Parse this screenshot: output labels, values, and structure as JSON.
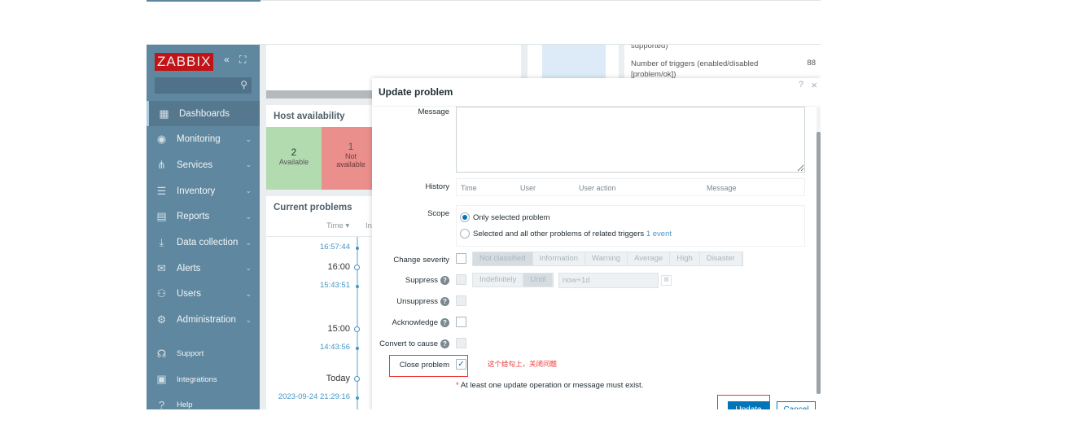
{
  "sidebar": {
    "logo": "ZABBIX",
    "items": [
      {
        "label": "Dashboards",
        "icon": "dashboard-icon",
        "active": true
      },
      {
        "label": "Monitoring",
        "icon": "eye-icon"
      },
      {
        "label": "Services",
        "icon": "hierarchy-icon"
      },
      {
        "label": "Inventory",
        "icon": "list-icon"
      },
      {
        "label": "Reports",
        "icon": "report-icon"
      },
      {
        "label": "Data collection",
        "icon": "download-icon"
      },
      {
        "label": "Alerts",
        "icon": "envelope-icon"
      },
      {
        "label": "Users",
        "icon": "users-icon"
      },
      {
        "label": "Administration",
        "icon": "gear-icon"
      }
    ],
    "bottom": [
      {
        "label": "Support",
        "icon": "headset-icon"
      },
      {
        "label": "Integrations",
        "icon": "integrations-icon"
      },
      {
        "label": "Help",
        "icon": "help-icon"
      }
    ]
  },
  "widgets": {
    "host_availability": {
      "title": "Host availability",
      "available_count": "2",
      "available_label": "Available",
      "not_available_count": "1",
      "not_available_label": "Not available",
      "colors": {
        "available": "#b2dcb0",
        "not_available": "#eb8f8d"
      }
    },
    "current_problems": {
      "title": "Current problems",
      "col_time": "Time ▾",
      "col_info": "In",
      "rows": [
        {
          "text": "16:57:44",
          "type": "event"
        },
        {
          "text": "16:00",
          "type": "mark"
        },
        {
          "text": "15:43:51",
          "type": "event"
        },
        {
          "text": "15:00",
          "type": "mark"
        },
        {
          "text": "14:43:56",
          "type": "event"
        },
        {
          "text": "Today",
          "type": "mark"
        },
        {
          "text": "2023-09-24 21:29:16",
          "type": "event"
        }
      ]
    },
    "system_info": {
      "row0": "supported)",
      "row1_label": "Number of triggers (enabled/disabled [problem/ok])",
      "row1_value": "88"
    }
  },
  "modal": {
    "title": "Update problem",
    "help": "?",
    "close": "×",
    "message_label": "Message",
    "history_label": "History",
    "history_cols": [
      "Time",
      "User",
      "User action",
      "Message"
    ],
    "scope_label": "Scope",
    "scope_options": [
      {
        "label": "Only selected problem",
        "checked": true
      },
      {
        "label": "Selected and all other problems of related triggers",
        "extra": "1 event",
        "checked": false
      }
    ],
    "change_severity_label": "Change severity",
    "severities": [
      "Not classified",
      "Information",
      "Warning",
      "Average",
      "High",
      "Disaster"
    ],
    "suppress_label": "Suppress",
    "suppress_options": [
      "Indefinitely",
      "Until"
    ],
    "suppress_until_value": "now+1d",
    "unsuppress_label": "Unsuppress",
    "acknowledge_label": "Acknowledge",
    "convert_label": "Convert to cause",
    "close_problem_label": "Close problem",
    "close_problem_checked": true,
    "annotation": "这个给勾上，关闭问题",
    "required_note": "At least one update operation or message must exist.",
    "required_mark": "*",
    "update_button": "Update",
    "cancel_button": "Cancel",
    "accent": "#0275b8"
  }
}
